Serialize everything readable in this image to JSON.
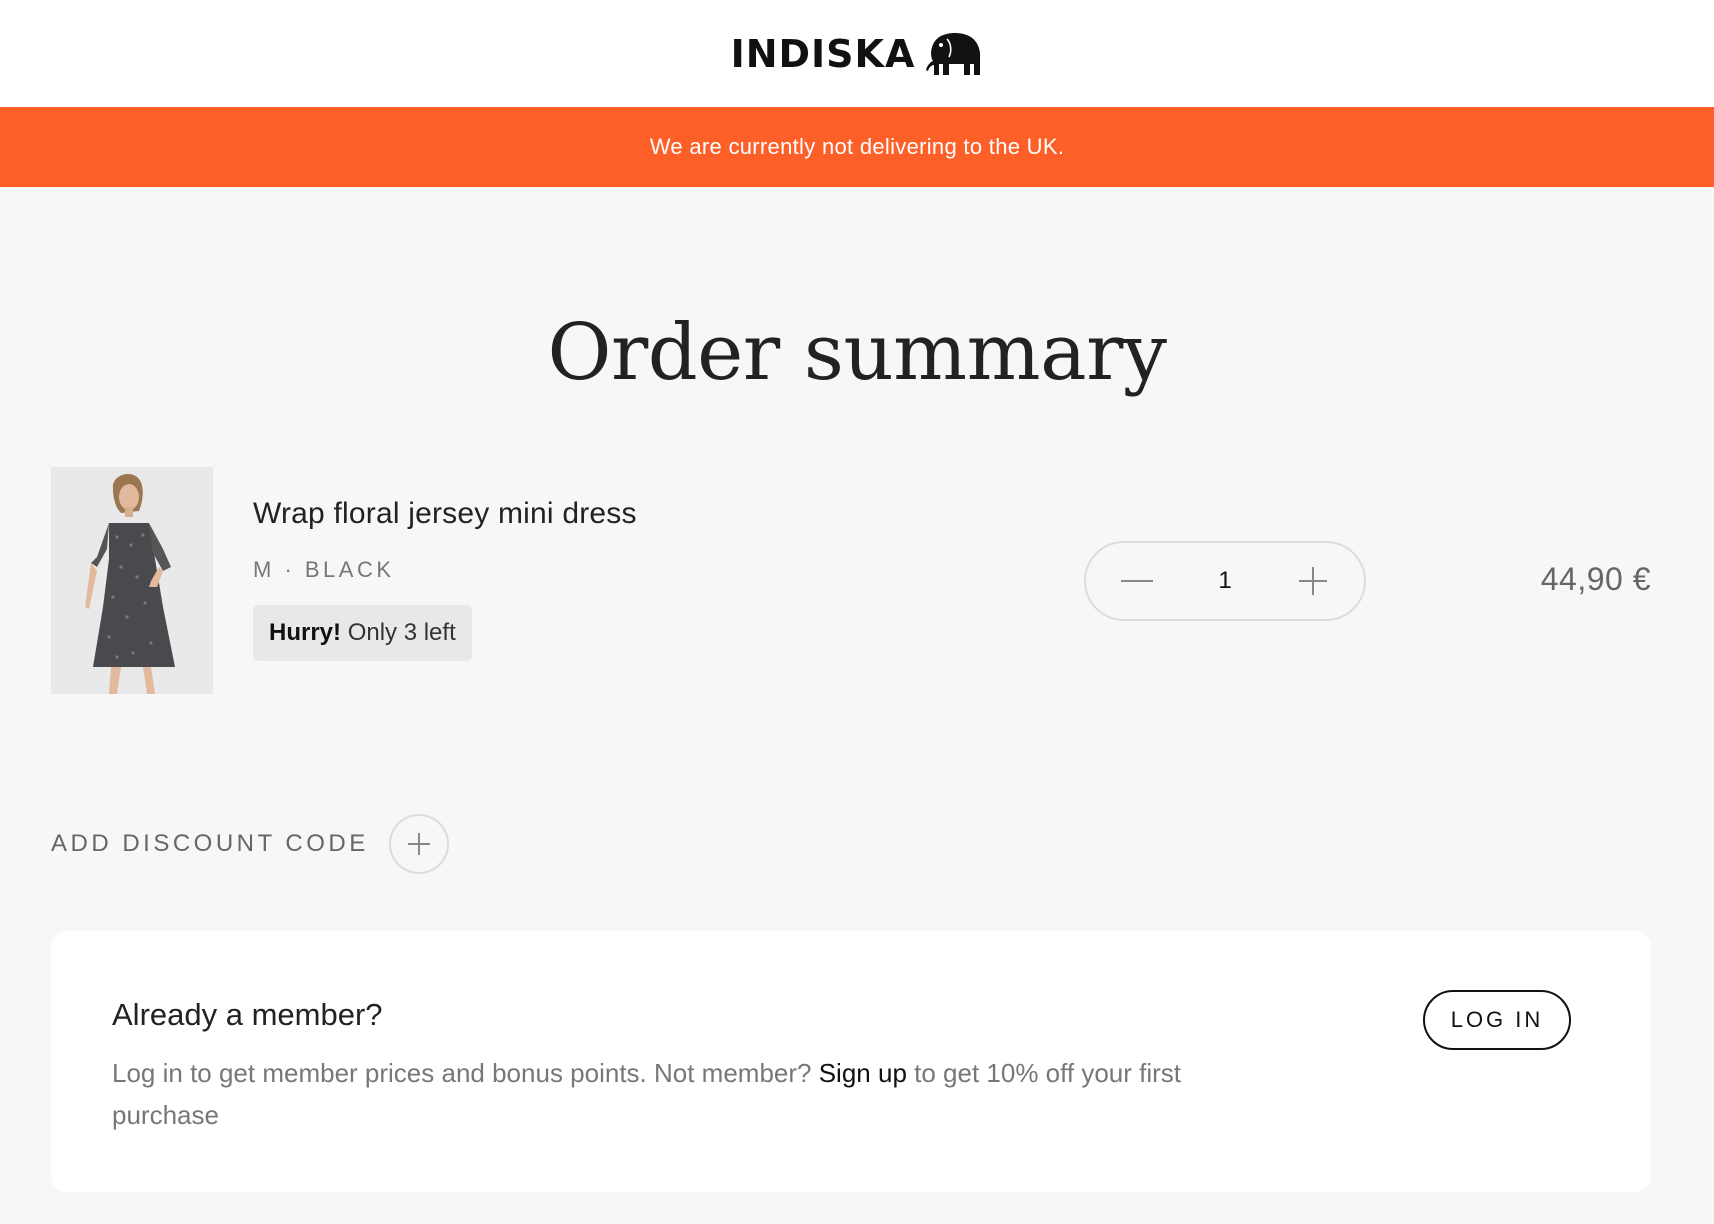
{
  "header": {
    "brand": "INDISKA",
    "logo_icon": "elephant-icon"
  },
  "banner": {
    "text": "We are currently not delivering to the UK.",
    "color": "#fc5f28"
  },
  "page": {
    "title": "Order summary"
  },
  "cart": {
    "items": [
      {
        "name": "Wrap floral jersey mini dress",
        "variant": "M · BLACK",
        "stock_emphasis": "Hurry!",
        "stock_text": "Only 3 left",
        "quantity": "1",
        "price": "44,90 €",
        "decrease_icon": "minus-icon",
        "increase_icon": "plus-icon"
      }
    ]
  },
  "discount": {
    "label": "ADD DISCOUNT CODE",
    "icon": "plus-icon"
  },
  "member": {
    "title": "Already a member?",
    "text_before": "Log in to get member prices and bonus points. Not member? ",
    "signup_link": "Sign up",
    "text_after": " to get 10% off your first purchase",
    "login_label": "LOG IN"
  }
}
